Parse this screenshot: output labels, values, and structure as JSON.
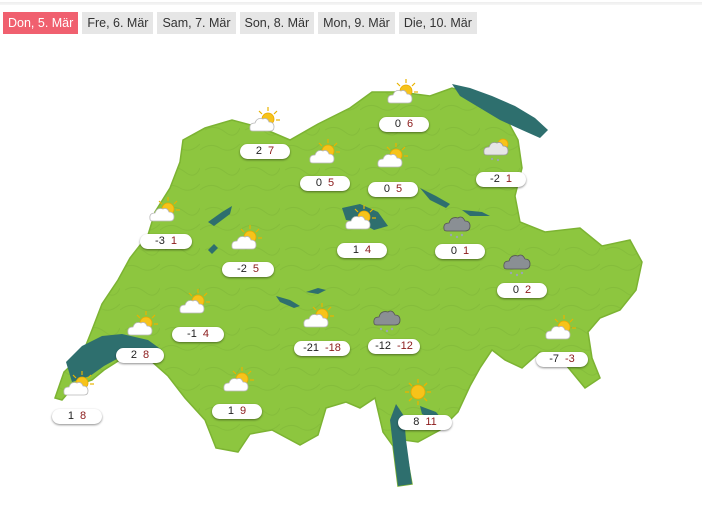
{
  "tabs": [
    {
      "label": "Don, 5. Mär",
      "active": true
    },
    {
      "label": "Fre, 6. Mär",
      "active": false
    },
    {
      "label": "Sam, 7. Mär",
      "active": false
    },
    {
      "label": "Son, 8. Mär",
      "active": false
    },
    {
      "label": "Mon, 9. Mär",
      "active": false
    },
    {
      "label": "Die, 10. Mär",
      "active": false
    }
  ],
  "colors": {
    "land": "#8dc63f",
    "land_edge": "#7cb332",
    "lake": "#2e6f6e",
    "active_tab": "#f0606f",
    "max_temp": "#8b1a1a"
  },
  "stations": [
    {
      "min": "0",
      "max": "6",
      "icon": "partly-cloudy-icon"
    },
    {
      "min": "2",
      "max": "7",
      "icon": "partly-cloudy-icon"
    },
    {
      "min": "0",
      "max": "5",
      "icon": "partly-cloudy-icon"
    },
    {
      "min": "0",
      "max": "5",
      "icon": "partly-cloudy-icon"
    },
    {
      "min": "-2",
      "max": "1",
      "icon": "cloudy-snow-icon"
    },
    {
      "min": "-3",
      "max": "1",
      "icon": "partly-cloudy-icon"
    },
    {
      "min": "-2",
      "max": "5",
      "icon": "partly-cloudy-icon"
    },
    {
      "min": "1",
      "max": "4",
      "icon": "partly-cloudy-icon"
    },
    {
      "min": "0",
      "max": "1",
      "icon": "snow-cloud-icon"
    },
    {
      "min": "0",
      "max": "2",
      "icon": "snow-cloud-icon"
    },
    {
      "min": "-1",
      "max": "4",
      "icon": "partly-cloudy-icon"
    },
    {
      "min": "-21",
      "max": "-18",
      "icon": "partly-cloudy-icon"
    },
    {
      "min": "-12",
      "max": "-12",
      "icon": "snow-cloud-icon"
    },
    {
      "min": "2",
      "max": "8",
      "icon": "partly-cloudy-icon"
    },
    {
      "min": "-7",
      "max": "-3",
      "icon": "partly-cloudy-icon"
    },
    {
      "min": "1",
      "max": "9",
      "icon": "partly-cloudy-icon"
    },
    {
      "min": "8",
      "max": "11",
      "icon": "sunny-icon"
    },
    {
      "min": "1",
      "max": "8",
      "icon": "partly-cloudy-icon"
    }
  ]
}
